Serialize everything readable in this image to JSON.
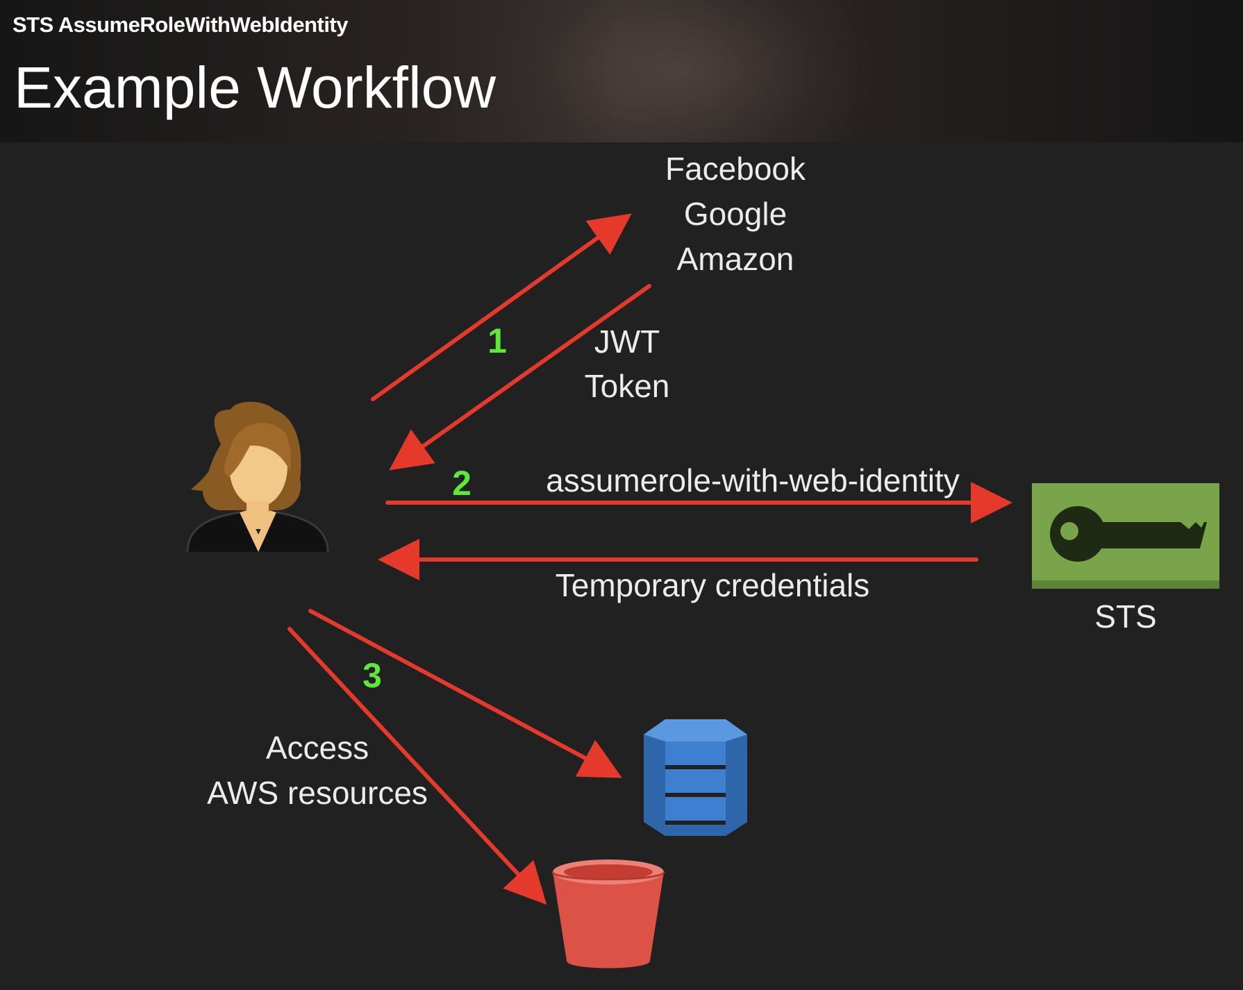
{
  "header": {
    "subtitle": "STS AssumeRoleWithWebIdentity",
    "title": "Example Workflow"
  },
  "providers": [
    "Facebook",
    "Google",
    "Amazon"
  ],
  "token_label": [
    "JWT",
    "Token"
  ],
  "steps": [
    "1",
    "2",
    "3"
  ],
  "assume_label": "assumerole-with-web-identity",
  "credentials_label": "Temporary credentials",
  "sts_label": "STS",
  "access_label": [
    "Access",
    "AWS resources"
  ],
  "colors": {
    "arrow": "#e53a2b",
    "step": "#5ee83a",
    "sts_box": "#7aa449",
    "dynamo": "#3f7fcf",
    "bucket": "#dd5247",
    "background": "#212121"
  },
  "icons": [
    "user-icon",
    "sts-key-icon",
    "dynamodb-icon",
    "s3-bucket-icon"
  ]
}
